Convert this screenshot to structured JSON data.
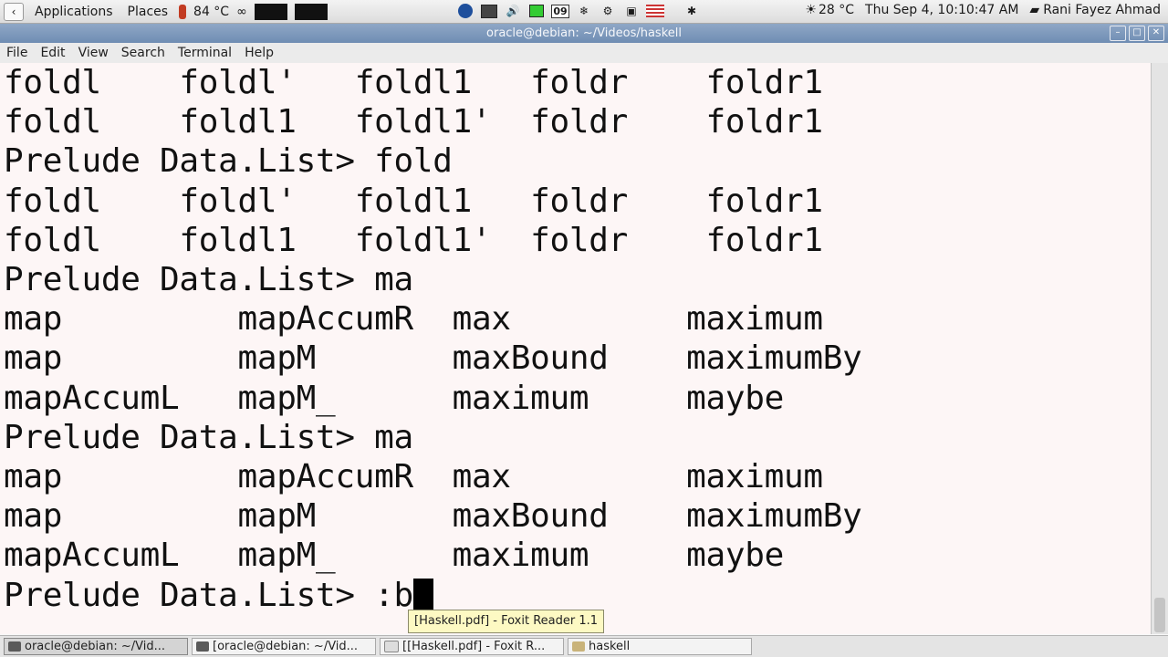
{
  "topbar": {
    "applications": "Applications",
    "places": "Places",
    "temp_left": "84 °C",
    "weather": "28 °C",
    "datetime": "Thu Sep  4, 10:10:47 AM",
    "user": "Rani Fayez Ahmad",
    "calendar_day": "09"
  },
  "window": {
    "title": "oracle@debian: ~/Videos/haskell",
    "menu": [
      "File",
      "Edit",
      "View",
      "Search",
      "Terminal",
      "Help"
    ]
  },
  "terminal": {
    "lines": [
      "foldl    foldl'   foldl1   foldr    foldr1",
      "foldl    foldl1   foldl1'  foldr    foldr1",
      "Prelude Data.List> fold",
      "foldl    foldl'   foldl1   foldr    foldr1",
      "foldl    foldl1   foldl1'  foldr    foldr1",
      "Prelude Data.List> ma",
      "map         mapAccumR  max         maximum",
      "map         mapM       maxBound    maximumBy",
      "mapAccumL   mapM_      maximum     maybe",
      "Prelude Data.List> ma",
      "map         mapAccumR  max         maximum",
      "map         mapM       maxBound    maximumBy",
      "mapAccumL   mapM_      maximum     maybe",
      "Prelude Data.List> :b"
    ]
  },
  "tooltip": "[Haskell.pdf] - Foxit Reader 1.1",
  "taskbar": {
    "items": [
      "oracle@debian: ~/Vid...",
      "[oracle@debian: ~/Vid...",
      "[[Haskell.pdf] - Foxit R...",
      "haskell"
    ]
  }
}
